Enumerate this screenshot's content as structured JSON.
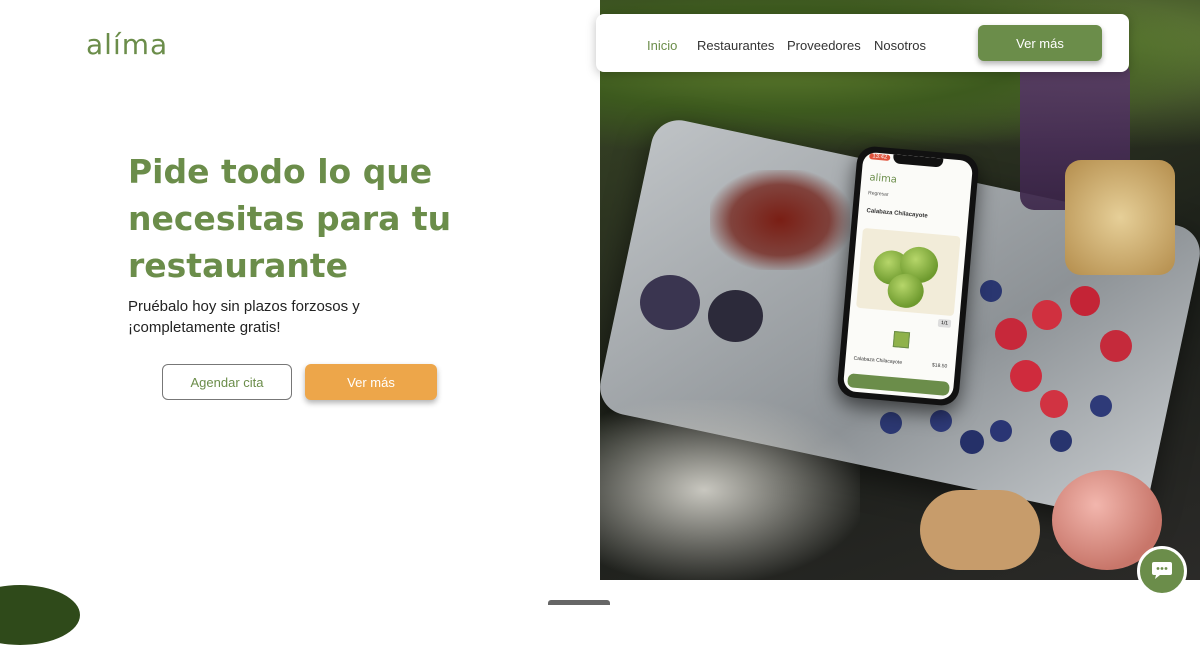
{
  "brand": {
    "logo_text": "alíma",
    "color": "#6b8d4a"
  },
  "nav": {
    "links": [
      {
        "label": "Inicio",
        "active": true
      },
      {
        "label": "Restaurantes",
        "active": false
      },
      {
        "label": "Proveedores",
        "active": false
      },
      {
        "label": "Nosotros",
        "active": false
      }
    ],
    "cta_label": "Ver más"
  },
  "hero": {
    "headline_lines": [
      "Pide todo lo que",
      "necesitas para tu",
      "restaurante"
    ],
    "subtext_lines": [
      "Pruébalo hoy sin plazos forzosos y",
      "¡completamente gratis!"
    ],
    "secondary_button": "Agendar cita",
    "primary_button": "Ver más",
    "primary_color": "#eda64a"
  },
  "phone": {
    "time": "13:42",
    "logo": "alima",
    "back_label": "Regresar",
    "product_name": "Calabaza Chilacayote",
    "qty": "1/1",
    "item_name": "Calabaza Chilacayote",
    "price": "$18.50"
  },
  "chat": {
    "icon": "chat-bubble-icon"
  }
}
